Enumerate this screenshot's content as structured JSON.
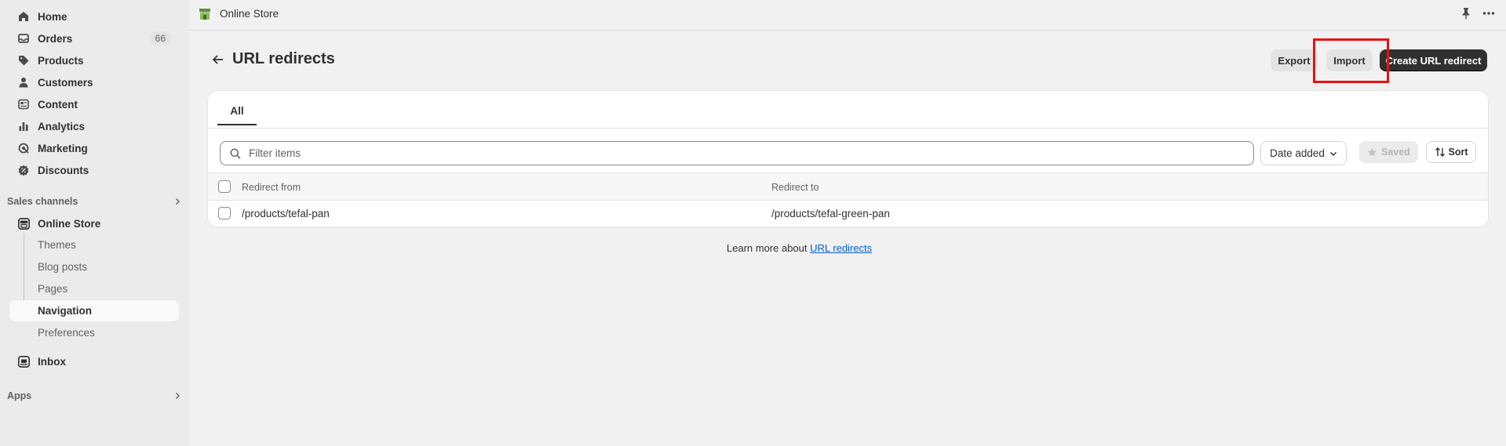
{
  "sidebar": {
    "items": [
      {
        "label": "Home",
        "icon": "home-icon"
      },
      {
        "label": "Orders",
        "icon": "orders-icon",
        "badge": "66"
      },
      {
        "label": "Products",
        "icon": "tag-icon"
      },
      {
        "label": "Customers",
        "icon": "person-icon"
      },
      {
        "label": "Content",
        "icon": "content-icon"
      },
      {
        "label": "Analytics",
        "icon": "bar-chart-icon"
      },
      {
        "label": "Marketing",
        "icon": "target-icon"
      },
      {
        "label": "Discounts",
        "icon": "discount-icon"
      }
    ],
    "sales_channels_label": "Sales channels",
    "online_store": {
      "label": "Online Store",
      "sub_items": [
        "Themes",
        "Blog posts",
        "Pages",
        "Navigation",
        "Preferences"
      ],
      "active": "Navigation"
    },
    "inbox_label": "Inbox",
    "apps_label": "Apps"
  },
  "topbar": {
    "store_name": "Online Store"
  },
  "page": {
    "title": "URL redirects",
    "export_label": "Export",
    "import_label": "Import",
    "create_label": "Create URL redirect"
  },
  "card": {
    "tab_all": "All",
    "filter_placeholder": "Filter items",
    "date_select": "Date added",
    "saved_label": "Saved",
    "sort_label": "Sort",
    "columns": [
      "Redirect from",
      "Redirect to"
    ],
    "rows": [
      {
        "from": "/products/tefal-pan",
        "to": "/products/tefal-green-pan"
      }
    ]
  },
  "footer": {
    "learn_more_text": "Learn more about",
    "learn_more_link": "URL redirects"
  },
  "colors": {
    "primary_button": "#303030",
    "link": "#005bd3",
    "highlight": "#e81111",
    "brand_green": "#5e8e3e"
  }
}
